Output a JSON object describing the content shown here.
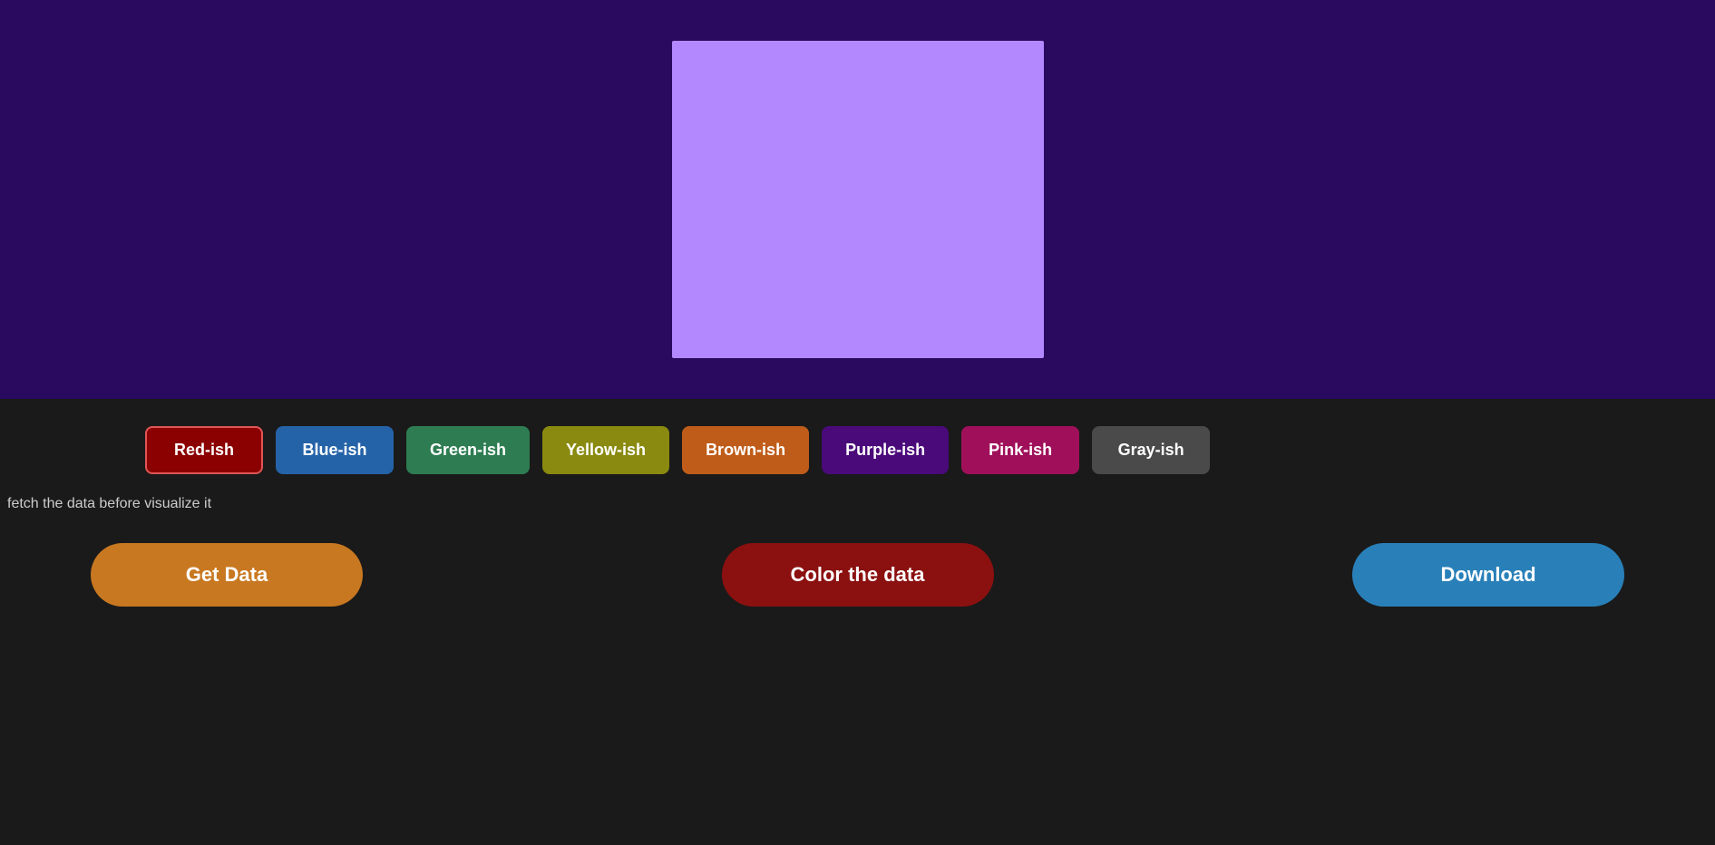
{
  "top": {
    "preview_color": "#b388ff",
    "background_color": "#2a0a5e"
  },
  "color_buttons": [
    {
      "id": "red",
      "label": "Red-ish",
      "bg": "#8b0000",
      "border": "#e05555"
    },
    {
      "id": "blue",
      "label": "Blue-ish",
      "bg": "#2563a8",
      "border": "#2563a8"
    },
    {
      "id": "green",
      "label": "Green-ish",
      "bg": "#2e7d52",
      "border": "#2e7d52"
    },
    {
      "id": "yellow",
      "label": "Yellow-ish",
      "bg": "#8a8a10",
      "border": "#8a8a10"
    },
    {
      "id": "brown",
      "label": "Brown-ish",
      "bg": "#c05c1a",
      "border": "#c05c1a"
    },
    {
      "id": "purple",
      "label": "Purple-ish",
      "bg": "#4a0a7a",
      "border": "#4a0a7a"
    },
    {
      "id": "pink",
      "label": "Pink-ish",
      "bg": "#a0105a",
      "border": "#a0105a"
    },
    {
      "id": "gray",
      "label": "Gray-ish",
      "bg": "#4a4a4a",
      "border": "#4a4a4a"
    }
  ],
  "status_text": "fetch the data before visualize it",
  "actions": {
    "get_data_label": "Get Data",
    "color_data_label": "Color the data",
    "download_label": "Download"
  }
}
